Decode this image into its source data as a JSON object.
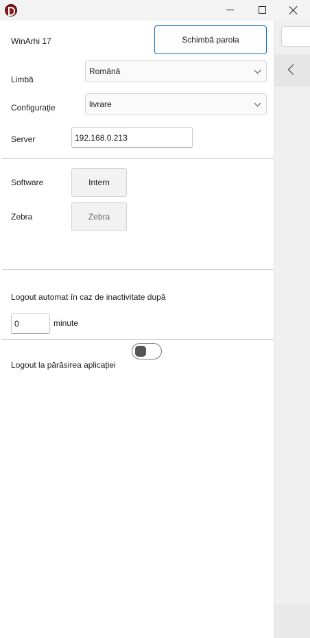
{
  "window": {
    "logo_icon": "app-logo-icon",
    "controls": [
      "minimize-icon",
      "maximize-icon",
      "close-icon"
    ]
  },
  "header": {
    "app_name": "WinArhi 17",
    "change_password_label": "Schimbă parola"
  },
  "settings": {
    "language_label": "Limbă",
    "language_value": "Română",
    "configuration_label": "Configurație",
    "configuration_value": "livrare",
    "server_label": "Server",
    "server_value": "192.168.0.213"
  },
  "devices": {
    "software_label": "Software",
    "software_button": "Intern",
    "zebra_label": "Zebra",
    "zebra_button": "Zebra"
  },
  "logout": {
    "auto_label": "Logout automat în caz de inactivitate după",
    "minutes_value": "0",
    "minutes_unit": "minute",
    "on_exit_label": "Logout la părăsirea aplicației",
    "on_exit_enabled": false
  },
  "side_panel": {
    "back_icon": "chevron-left-icon"
  }
}
